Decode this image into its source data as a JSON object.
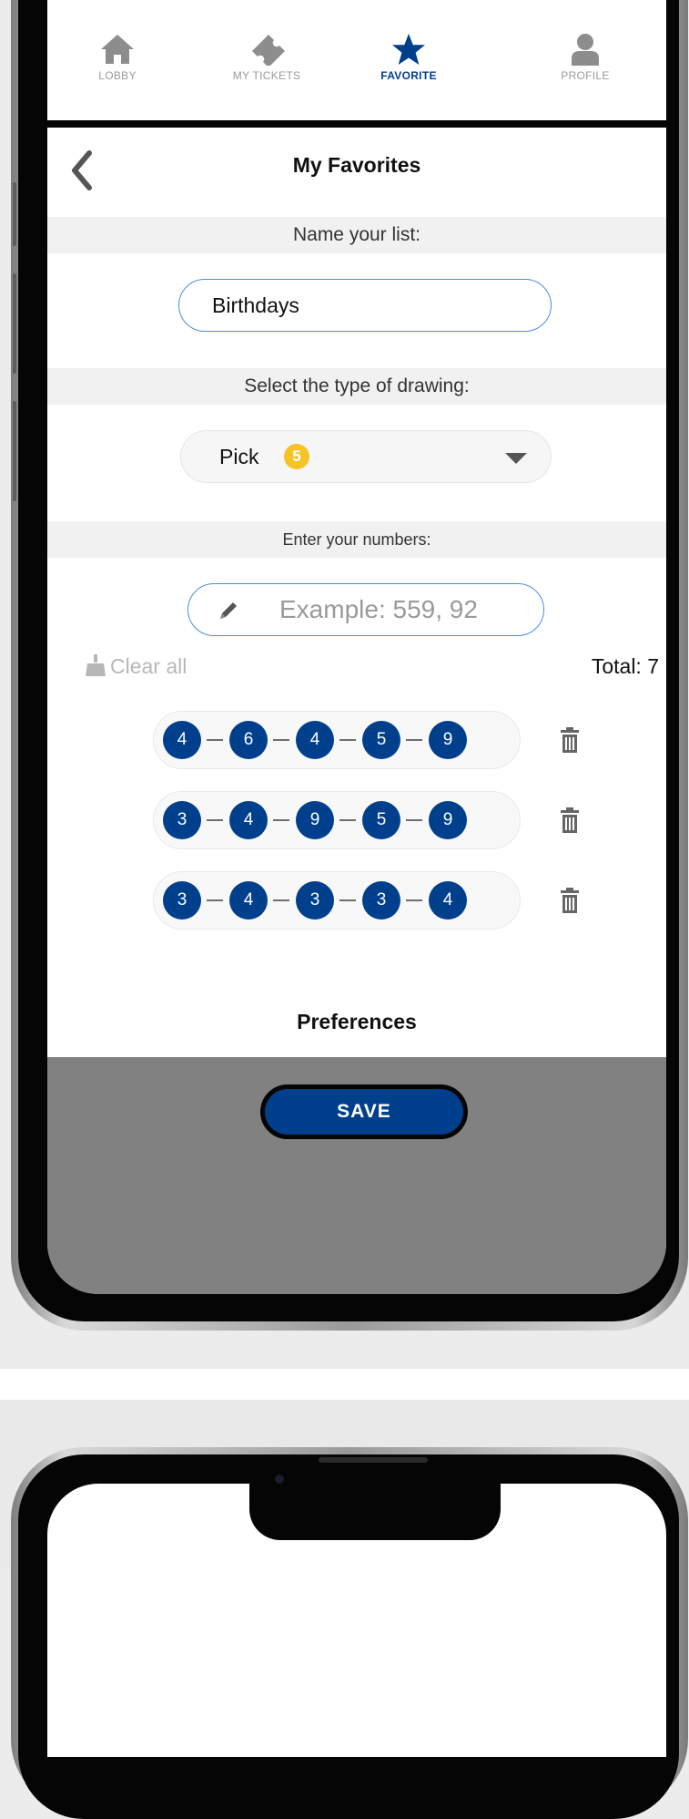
{
  "nav": {
    "items": [
      {
        "label": "LOBBY",
        "icon": "home-icon"
      },
      {
        "label": "MY TICKETS",
        "icon": "ticket-icon"
      },
      {
        "label": "FAVORITE",
        "icon": "star-icon",
        "active": true
      },
      {
        "label": "PROFILE",
        "icon": "profile-icon"
      }
    ]
  },
  "page": {
    "title": "My Favorites"
  },
  "list_name": {
    "label": "Name your list:",
    "value": "Birthdays"
  },
  "drawing": {
    "label": "Select the type of drawing:",
    "selected": "Pick",
    "badge": "5"
  },
  "numbers": {
    "label": "Enter your numbers:",
    "placeholder": "Example: 559, 92",
    "clear_label": "Clear all",
    "total_label": "Total: 7",
    "combos": [
      [
        "4",
        "6",
        "4",
        "5",
        "9"
      ],
      [
        "3",
        "4",
        "9",
        "5",
        "9"
      ],
      [
        "3",
        "4",
        "3",
        "3",
        "4"
      ]
    ]
  },
  "preferences": {
    "title": "Preferences"
  },
  "save": {
    "label": "SAVE"
  },
  "colors": {
    "primary": "#003f8c",
    "badge": "#f5c227",
    "input_border": "#4a8ee0",
    "bottom_bar": "#818181"
  }
}
